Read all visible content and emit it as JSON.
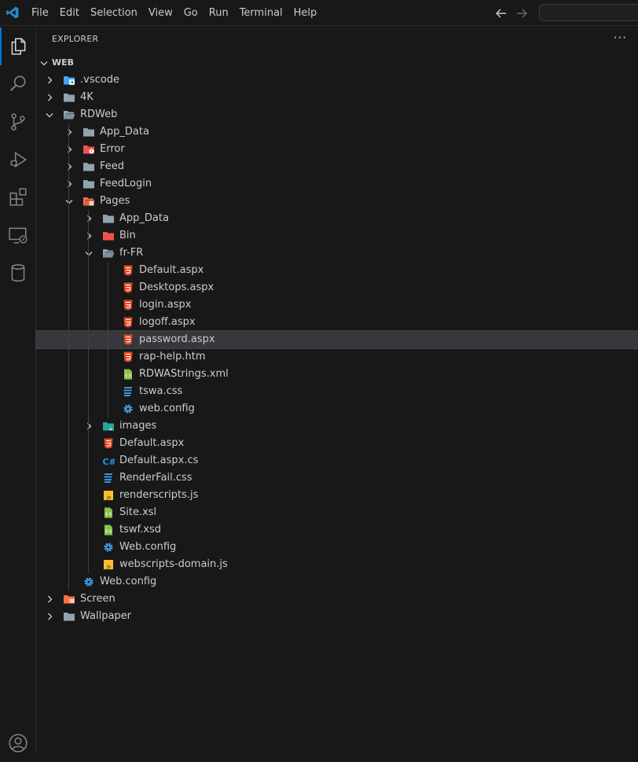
{
  "menu": [
    "File",
    "Edit",
    "Selection",
    "View",
    "Go",
    "Run",
    "Terminal",
    "Help"
  ],
  "explorer": {
    "title": "EXPLORER",
    "more": "···"
  },
  "tree": [
    {
      "label": "WEB",
      "depth": 0,
      "kind": "root",
      "expanded": true
    },
    {
      "label": ".vscode",
      "depth": 1,
      "kind": "folder-vscode",
      "expanded": false
    },
    {
      "label": "4K",
      "depth": 1,
      "kind": "folder",
      "expanded": false
    },
    {
      "label": "RDWeb",
      "depth": 1,
      "kind": "folder",
      "expanded": true
    },
    {
      "label": "App_Data",
      "depth": 2,
      "kind": "folder",
      "expanded": false
    },
    {
      "label": "Error",
      "depth": 2,
      "kind": "folder-error",
      "expanded": false
    },
    {
      "label": "Feed",
      "depth": 2,
      "kind": "folder",
      "expanded": false
    },
    {
      "label": "FeedLogin",
      "depth": 2,
      "kind": "folder",
      "expanded": false
    },
    {
      "label": "Pages",
      "depth": 2,
      "kind": "folder-pages",
      "expanded": true
    },
    {
      "label": "App_Data",
      "depth": 3,
      "kind": "folder",
      "expanded": false
    },
    {
      "label": "Bin",
      "depth": 3,
      "kind": "folder-bin",
      "expanded": false
    },
    {
      "label": "fr-FR",
      "depth": 3,
      "kind": "folder",
      "expanded": true
    },
    {
      "label": "Default.aspx",
      "depth": 4,
      "kind": "html"
    },
    {
      "label": "Desktops.aspx",
      "depth": 4,
      "kind": "html"
    },
    {
      "label": "login.aspx",
      "depth": 4,
      "kind": "html"
    },
    {
      "label": "logoff.aspx",
      "depth": 4,
      "kind": "html"
    },
    {
      "label": "password.aspx",
      "depth": 4,
      "kind": "html",
      "selected": true
    },
    {
      "label": "rap-help.htm",
      "depth": 4,
      "kind": "html"
    },
    {
      "label": "RDWAStrings.xml",
      "depth": 4,
      "kind": "xml"
    },
    {
      "label": "tswa.css",
      "depth": 4,
      "kind": "css"
    },
    {
      "label": "web.config",
      "depth": 4,
      "kind": "config"
    },
    {
      "label": "images",
      "depth": 3,
      "kind": "folder-images",
      "expanded": false
    },
    {
      "label": "Default.aspx",
      "depth": 3,
      "kind": "html"
    },
    {
      "label": "Default.aspx.cs",
      "depth": 3,
      "kind": "csharp"
    },
    {
      "label": "RenderFail.css",
      "depth": 3,
      "kind": "css"
    },
    {
      "label": "renderscripts.js",
      "depth": 3,
      "kind": "js"
    },
    {
      "label": "Site.xsl",
      "depth": 3,
      "kind": "xml"
    },
    {
      "label": "tswf.xsd",
      "depth": 3,
      "kind": "xml"
    },
    {
      "label": "Web.config",
      "depth": 3,
      "kind": "config"
    },
    {
      "label": "webscripts-domain.js",
      "depth": 3,
      "kind": "js"
    },
    {
      "label": "Web.config",
      "depth": 2,
      "kind": "config"
    },
    {
      "label": "Screen",
      "depth": 1,
      "kind": "folder-screen",
      "expanded": false
    },
    {
      "label": "Wallpaper",
      "depth": 1,
      "kind": "folder",
      "expanded": false
    }
  ],
  "colors": {
    "accent": "#0078d4",
    "selection": "#37373d",
    "folder": "#90a4ae",
    "html": "#e44d26",
    "css": "#42a5f5",
    "js": "#fbc02d",
    "xml": "#8bc34a",
    "config": "#42a5f5",
    "csharp": "#2196f3"
  }
}
